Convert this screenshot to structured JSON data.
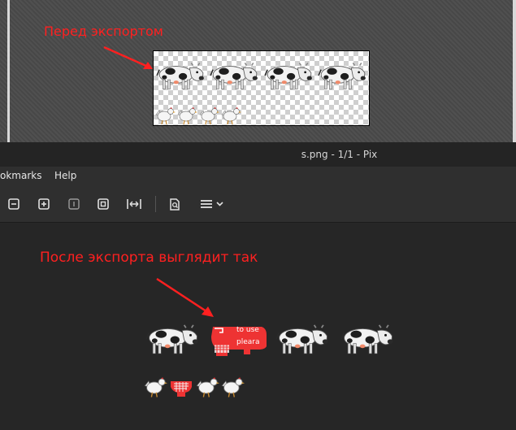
{
  "annotations": {
    "before": "Перед экспортом",
    "after": "После экспорта выглядит так"
  },
  "window": {
    "title": "s.png - 1/1 - Pix"
  },
  "menubar": {
    "items": [
      "okmarks",
      "Help"
    ]
  },
  "toolbar": {
    "buttons": [
      "zoom-out-icon",
      "zoom-in-icon",
      "actual-size-icon",
      "zoom-fit-icon",
      "fit-width-icon",
      "image-info-icon",
      "menu-icon"
    ]
  },
  "corrupted_sprite_text": {
    "line1": "to use",
    "line2": "pleara"
  },
  "colors": {
    "annotation": "#ff2020",
    "corruption": "#ee3333"
  }
}
